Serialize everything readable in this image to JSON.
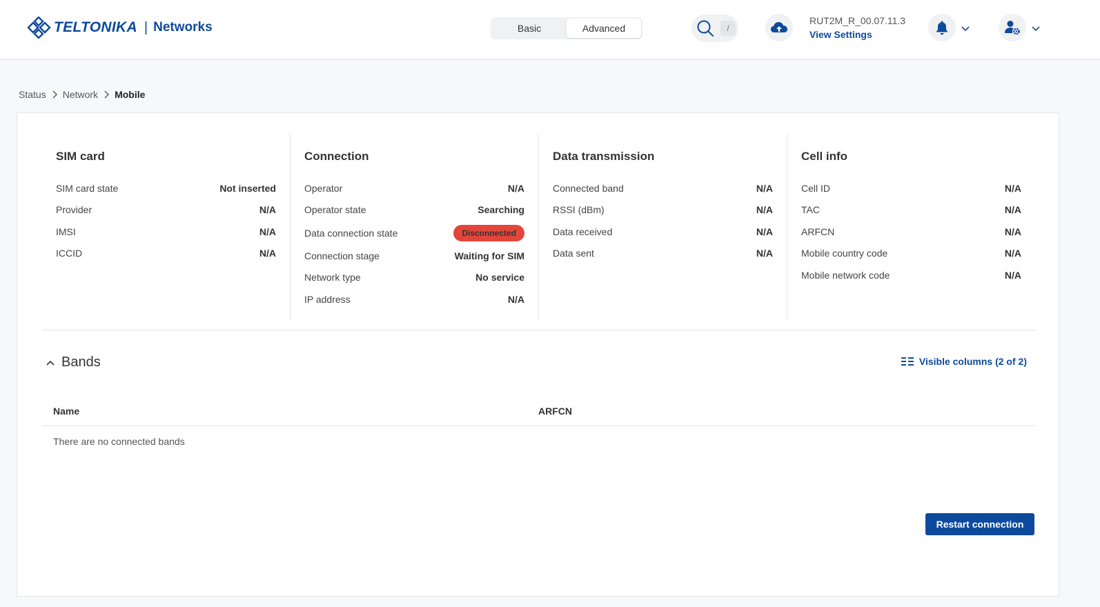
{
  "header": {
    "brand": "TELTONIKA",
    "separator": "|",
    "brand_sub": "Networks",
    "modes": [
      "Basic",
      "Advanced"
    ],
    "active_mode": "Advanced",
    "search_shortcut": "/",
    "firmware": "RUT2M_R_00.07.11.3",
    "view_settings": "View Settings"
  },
  "breadcrumb": [
    "Status",
    "Network",
    "Mobile"
  ],
  "sim": {
    "title": "SIM card",
    "rows": [
      {
        "label": "SIM card state",
        "value": "Not inserted"
      },
      {
        "label": "Provider",
        "value": "N/A"
      },
      {
        "label": "IMSI",
        "value": "N/A"
      },
      {
        "label": "ICCID",
        "value": "N/A"
      }
    ]
  },
  "connection": {
    "title": "Connection",
    "rows": [
      {
        "label": "Operator",
        "value": "N/A"
      },
      {
        "label": "Operator state",
        "value": "Searching"
      },
      {
        "label": "Data connection state",
        "value": "Disconnected"
      },
      {
        "label": "Connection stage",
        "value": "Waiting for SIM"
      },
      {
        "label": "Network type",
        "value": "No service"
      },
      {
        "label": "IP address",
        "value": "N/A"
      }
    ]
  },
  "data_tx": {
    "title": "Data transmission",
    "rows": [
      {
        "label": "Connected band",
        "value": "N/A"
      },
      {
        "label": "RSSI (dBm)",
        "value": "N/A"
      },
      {
        "label": "Data received",
        "value": "N/A"
      },
      {
        "label": "Data sent",
        "value": "N/A"
      }
    ]
  },
  "cell": {
    "title": "Cell info",
    "rows": [
      {
        "label": "Cell ID",
        "value": "N/A"
      },
      {
        "label": "TAC",
        "value": "N/A"
      },
      {
        "label": "ARFCN",
        "value": "N/A"
      },
      {
        "label": "Mobile country code",
        "value": "N/A"
      },
      {
        "label": "Mobile network code",
        "value": "N/A"
      }
    ]
  },
  "bands": {
    "title": "Bands",
    "visible_columns": "Visible columns (2 of 2)",
    "columns": [
      "Name",
      "ARFCN"
    ],
    "empty": "There are no connected bands"
  },
  "actions": {
    "restart": "Restart connection"
  },
  "colors": {
    "brand": "#0d4a9c",
    "danger": "#e2463a"
  }
}
